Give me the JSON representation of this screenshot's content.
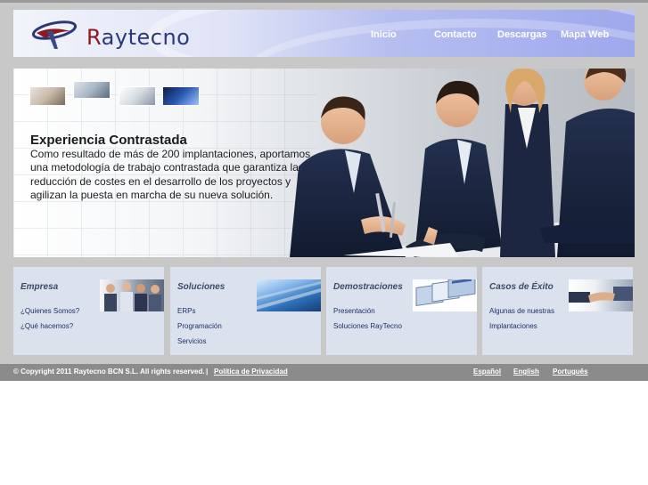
{
  "brand": {
    "name": "Raytecno",
    "colors": {
      "navy": "#2b3a77",
      "accent": "#8b1a22"
    }
  },
  "nav": {
    "items": [
      {
        "label": "Inicio"
      },
      {
        "label": "Contacto"
      },
      {
        "label": "Descargas"
      },
      {
        "label": "Mapa Web"
      }
    ]
  },
  "hero": {
    "title": "Experiencia Contrastada",
    "body": "Como resultado de más de 200 implantaciones, aportamos una metodología de trabajo contrastada que garantiza la reducción de costes en el desarrollo de los proyectos y agilizan la puesta en marcha de su nueva solución."
  },
  "boxes": [
    {
      "title": "Empresa",
      "links": [
        "¿Quienes Somos?",
        "¿Qué hacemos?"
      ]
    },
    {
      "title": "Soluciones",
      "links": [
        "ERPs",
        "Programación",
        "Servicios"
      ]
    },
    {
      "title": "Demostraciones",
      "links": [
        "Presentación",
        "Soluciones RayTecno"
      ]
    },
    {
      "title": "Casos de Éxito",
      "links": [
        "Algunas de nuestras",
        "Implantaciones"
      ]
    }
  ],
  "footer": {
    "copyright": "© Copyright 2011 Raytecno BCN S.L. All rights reserved.",
    "separator": "|",
    "privacy": "Política de Privacidad",
    "languages": [
      "Español",
      "English",
      "Português"
    ]
  }
}
